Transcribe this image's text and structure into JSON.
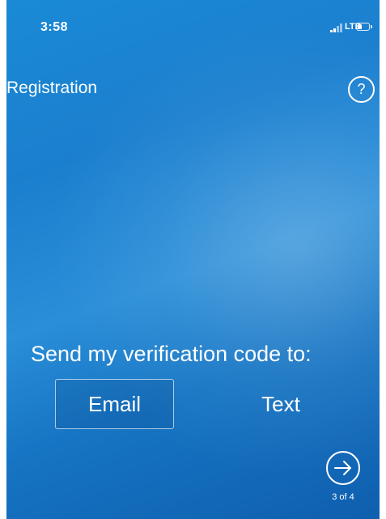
{
  "status_bar": {
    "time": "3:58",
    "network": "LTE",
    "signal_icon": "cellular-signal-icon",
    "battery_icon": "battery-icon",
    "battery_level": 0.3
  },
  "header": {
    "title": "Registration",
    "help_label": "?",
    "help_icon": "question-mark-icon"
  },
  "verification": {
    "prompt": "Send my verification code to:",
    "options": [
      {
        "label": "Email",
        "selected": true
      },
      {
        "label": "Text",
        "selected": false
      }
    ]
  },
  "footer": {
    "next_icon": "arrow-right-circle-icon",
    "step": "3 of 4"
  },
  "colors": {
    "background_top": "#1a8ad6",
    "background_bottom": "#0f5fae",
    "foreground": "#ffffff"
  }
}
